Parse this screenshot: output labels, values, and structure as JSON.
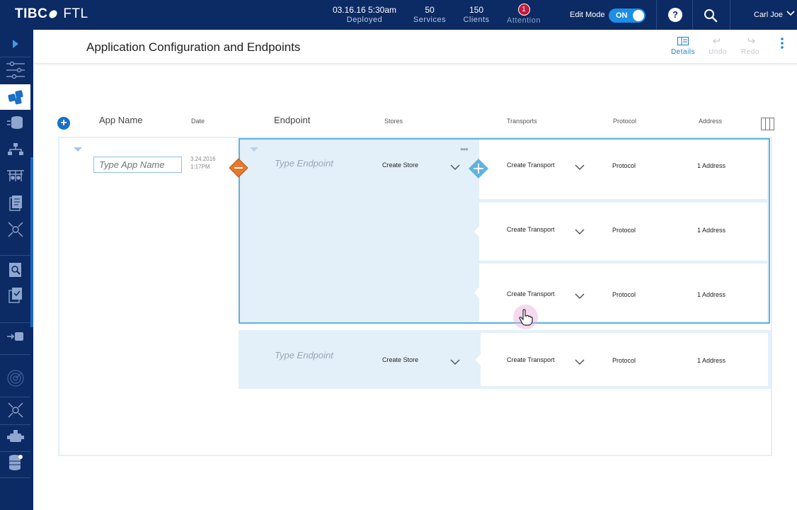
{
  "app": {
    "brand": "TIBC",
    "product": "FTL"
  },
  "status": {
    "deployed": {
      "value": "03.16.16 5:30am",
      "label": "Deployed"
    },
    "services": {
      "value": "50",
      "label": "Services"
    },
    "clients": {
      "value": "150",
      "label": "Clients"
    },
    "attention": {
      "count": "1",
      "label": "Attention"
    }
  },
  "edit_mode": {
    "label": "Edit Mode",
    "state": "ON"
  },
  "help": {
    "label": "?"
  },
  "user": {
    "name": "Carl Joe"
  },
  "sidenav": {
    "items": [
      "expand-icon",
      "sliders-icon",
      "applications-icon",
      "endpoints-icon",
      "network-icon",
      "transports-icon",
      "document-icon",
      "satellite-icon",
      "search-doc-icon",
      "checklist-icon",
      "import-icon",
      "radar-icon",
      "satellite-icon",
      "plugin-icon",
      "database-icon"
    ],
    "active": "applications-icon",
    "accent": "#0c2a63"
  },
  "page": {
    "title": "Application Configuration and Endpoints"
  },
  "toolbar": {
    "details": "Details",
    "undo": "Undo",
    "redo": "Redo"
  },
  "table": {
    "headers": {
      "app_name": "App Name",
      "date": "Date",
      "endpoint": "Endpoint",
      "stores": "Stores",
      "transports": "Transports",
      "protocol": "Protocol",
      "address": "Address"
    },
    "row": {
      "app_name_placeholder": "Type App Name",
      "date": "3.24.2016",
      "time": "1:17PM",
      "endpoints": [
        {
          "placeholder": "Type Endpoint",
          "store": "Create Store",
          "transports": [
            {
              "label": "Create Transport",
              "protocol": "Protocol",
              "address": "1 Address"
            },
            {
              "label": "Create Transport",
              "protocol": "Protocol",
              "address": "1 Address"
            },
            {
              "label": "Create Transport",
              "protocol": "Protocol",
              "address": "1 Address"
            }
          ]
        },
        {
          "placeholder": "Type Endpoint",
          "store": "Create Store",
          "transports": [
            {
              "label": "Create Transport",
              "protocol": "Protocol",
              "address": "1 Address"
            }
          ]
        }
      ]
    }
  },
  "colors": {
    "accent": "#1c8ee6",
    "selected_border": "#5fb3e0",
    "endpoint_bg": "#e3f0fa",
    "remove": "#e8782a"
  }
}
